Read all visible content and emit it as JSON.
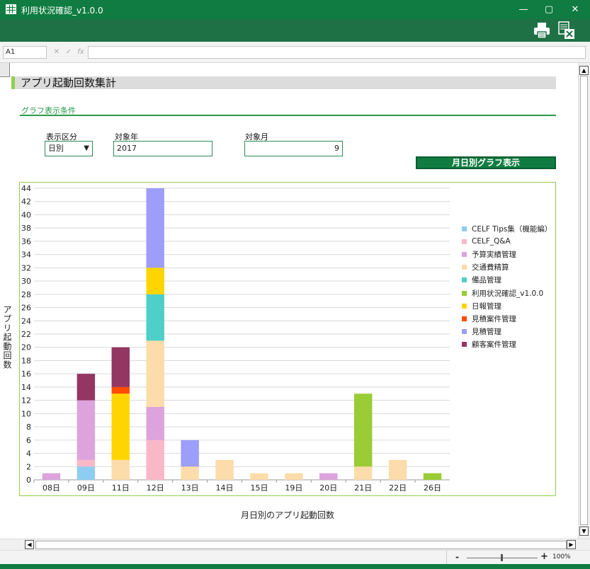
{
  "window": {
    "title": "利用状況確認_v1.0.0",
    "minimize": "—",
    "maximize": "▢",
    "close": "✕"
  },
  "formula_bar": {
    "name_box": "A1",
    "cancel": "✕",
    "enter": "✓",
    "fx": "fx"
  },
  "sheet": {
    "heading": "アプリ起動回数集計",
    "section_label": "グラフ表示条件",
    "display_type": {
      "label": "表示区分",
      "value": "日別"
    },
    "target_year": {
      "label": "対象年",
      "value": "2017"
    },
    "target_month": {
      "label": "対象月",
      "value": "9"
    },
    "graph_button": "月日別グラフ表示"
  },
  "status_bar": {
    "zoom_minus": "-",
    "zoom_plus": "+",
    "zoom_level": "100%"
  },
  "chart_data": {
    "type": "bar",
    "stacked": true,
    "title": "月日別のアプリ起動回数",
    "ylabel": "アプリ起動回数",
    "xlabel": "",
    "ylim": [
      0,
      44
    ],
    "ytick_step": 2,
    "grid": true,
    "legend_position": "right",
    "categories": [
      "08日",
      "09日",
      "11日",
      "12日",
      "13日",
      "14日",
      "15日",
      "19日",
      "20日",
      "21日",
      "22日",
      "26日"
    ],
    "series": [
      {
        "name": "CELF Tips集（機能編）",
        "color": "#8ecdf2",
        "values": [
          0,
          2,
          0,
          0,
          0,
          0,
          0,
          0,
          0,
          0,
          0,
          0
        ]
      },
      {
        "name": "CELF_Q&A",
        "color": "#f9b8c8",
        "values": [
          0,
          1,
          0,
          6,
          0,
          0,
          0,
          0,
          0,
          0,
          0,
          0
        ]
      },
      {
        "name": "予算実績管理",
        "color": "#dca3dc",
        "values": [
          1,
          9,
          0,
          5,
          0,
          0,
          0,
          0,
          1,
          0,
          0,
          0
        ]
      },
      {
        "name": "交通費精算",
        "color": "#fcdcaa",
        "values": [
          0,
          0,
          3,
          10,
          2,
          3,
          1,
          1,
          0,
          2,
          3,
          0
        ]
      },
      {
        "name": "備品管理",
        "color": "#4ecfc8",
        "values": [
          0,
          0,
          0,
          7,
          0,
          0,
          0,
          0,
          0,
          0,
          0,
          0
        ]
      },
      {
        "name": "利用状況確認_v1.0.0",
        "color": "#9acc35",
        "values": [
          0,
          0,
          0,
          0,
          0,
          0,
          0,
          0,
          0,
          11,
          0,
          1
        ]
      },
      {
        "name": "日報管理",
        "color": "#ffd500",
        "values": [
          0,
          0,
          10,
          4,
          0,
          0,
          0,
          0,
          0,
          0,
          0,
          0
        ]
      },
      {
        "name": "見積案件管理",
        "color": "#ff4c00",
        "values": [
          0,
          0,
          1,
          0,
          0,
          0,
          0,
          0,
          0,
          0,
          0,
          0
        ]
      },
      {
        "name": "見積管理",
        "color": "#9d9dfa",
        "values": [
          0,
          0,
          0,
          12,
          4,
          0,
          0,
          0,
          0,
          0,
          0,
          0
        ]
      },
      {
        "name": "顧客案件管理",
        "color": "#943662",
        "values": [
          0,
          4,
          6,
          0,
          0,
          0,
          0,
          0,
          0,
          0,
          0,
          0
        ]
      }
    ]
  }
}
